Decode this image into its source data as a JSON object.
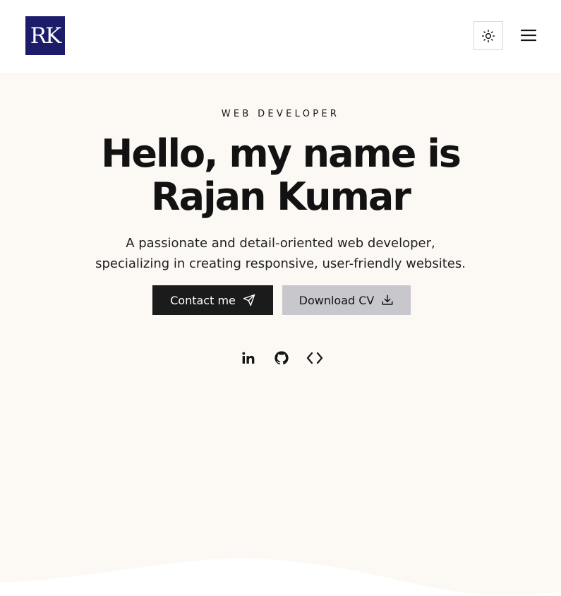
{
  "header": {
    "logo_text": "RK",
    "theme_toggle_icon": "sun-icon",
    "menu_icon": "hamburger-menu-icon"
  },
  "hero": {
    "kicker": "WEB DEVELOPER",
    "title_line1": "Hello, my name is",
    "title_line2": "Rajan Kumar",
    "subtitle_line1": "A passionate and detail-oriented web developer,",
    "subtitle_line2": "specializing in creating responsive, user-friendly websites.",
    "contact_label": "Contact me",
    "contact_icon": "send-icon",
    "download_label": "Download CV",
    "download_icon": "download-icon",
    "socials": [
      "linkedin-icon",
      "github-icon",
      "code-icon"
    ]
  },
  "colors": {
    "logo_bg": "#1c1c6b",
    "hero_bg": "#fcf8f4",
    "contact_bg": "#1b1b1b",
    "download_bg": "#c8c7cc"
  }
}
